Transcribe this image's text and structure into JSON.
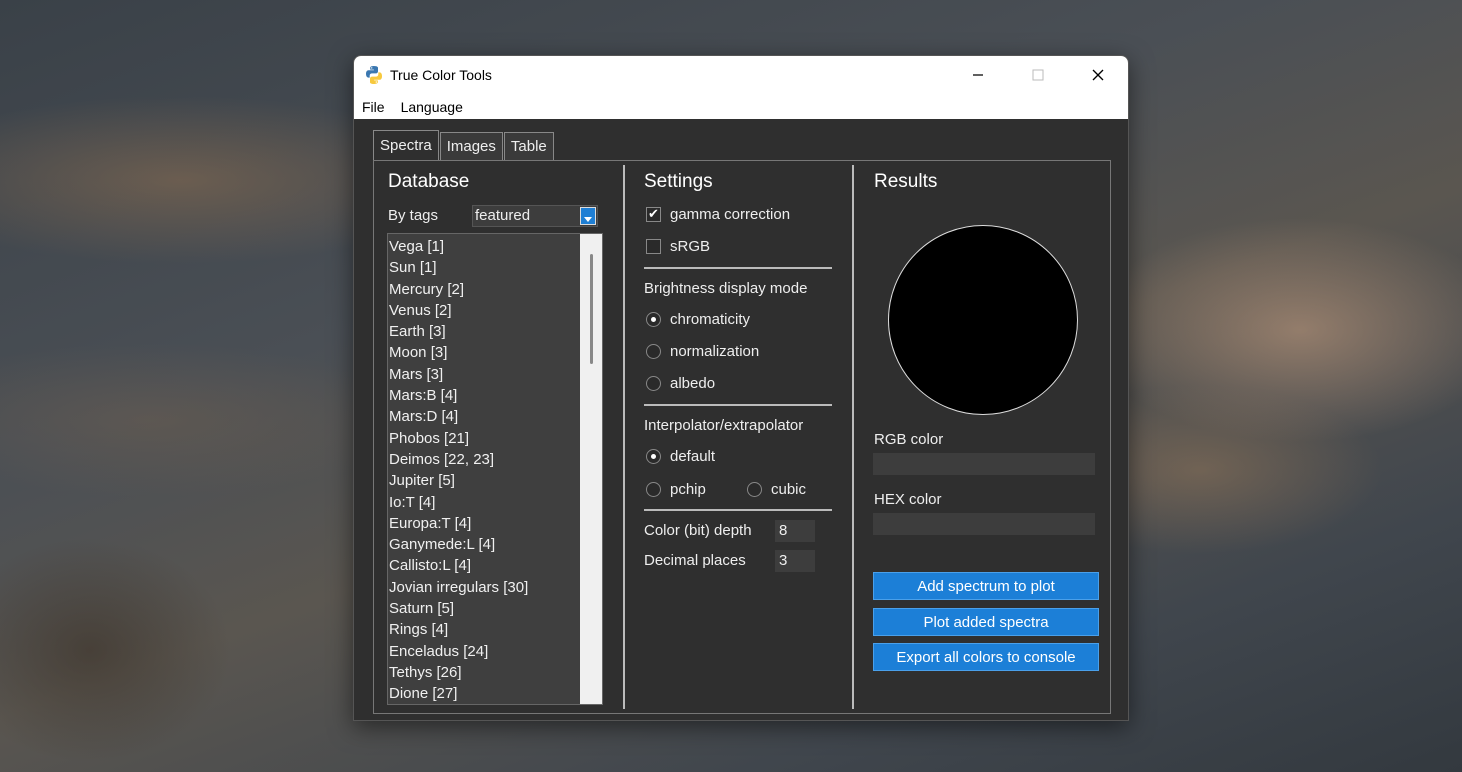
{
  "window": {
    "title": "True Color Tools",
    "minimize_glyph": "—",
    "maximize_glyph": "☐",
    "close_glyph": "✕"
  },
  "menu": {
    "file": "File",
    "language": "Language"
  },
  "tabs": [
    {
      "label": "Spectra",
      "active": true
    },
    {
      "label": "Images",
      "active": false
    },
    {
      "label": "Table",
      "active": false
    }
  ],
  "database": {
    "heading": "Database",
    "by_tags_label": "By tags",
    "tags_value": "featured",
    "items": [
      "Vega [1]",
      "Sun [1]",
      "Mercury [2]",
      "Venus [2]",
      "Earth [3]",
      "Moon [3]",
      "Mars [3]",
      "Mars:B [4]",
      "Mars:D [4]",
      "Phobos [21]",
      "Deimos [22, 23]",
      "Jupiter [5]",
      "Io:T [4]",
      "Europa:T [4]",
      "Ganymede:L [4]",
      "Callisto:L [4]",
      "Jovian irregulars [30]",
      "Saturn [5]",
      "Rings [4]",
      "Enceladus [24]",
      "Tethys [26]",
      "Dione [27]"
    ]
  },
  "settings": {
    "heading": "Settings",
    "gamma_correction": {
      "label": "gamma correction",
      "checked": true
    },
    "srgb": {
      "label": "sRGB",
      "checked": false
    },
    "brightness_heading": "Brightness display mode",
    "brightness_options": [
      "chromaticity",
      "normalization",
      "albedo"
    ],
    "brightness_selected": "chromaticity",
    "interp_heading": "Interpolator/extrapolator",
    "interp_options": [
      "default",
      "pchip",
      "cubic"
    ],
    "interp_selected": "default",
    "bit_depth_label": "Color (bit) depth",
    "bit_depth_value": "8",
    "decimal_label": "Decimal places",
    "decimal_value": "3",
    "check_glyph": "✔"
  },
  "results": {
    "heading": "Results",
    "circle_color": "#000000",
    "rgb_label": "RGB color",
    "rgb_value": "",
    "hex_label": "HEX color",
    "hex_value": "",
    "buttons": {
      "add": "Add spectrum to plot",
      "plot": "Plot added spectra",
      "export": "Export all colors to console"
    }
  },
  "colors": {
    "accent": "#1c7fd7",
    "panel": "#2f2f2f"
  }
}
